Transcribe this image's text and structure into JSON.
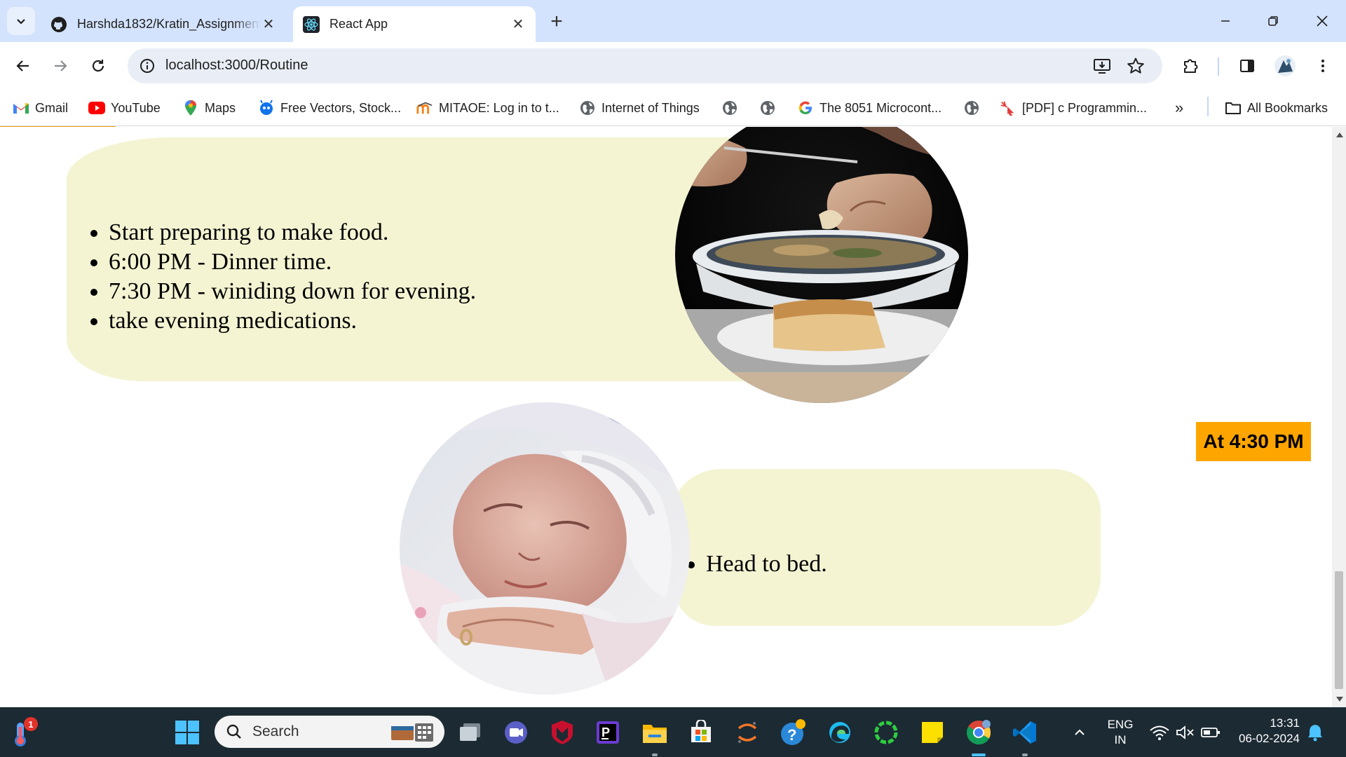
{
  "browser": {
    "tabs": [
      {
        "title": "Harshda1832/Kratin_Assignment",
        "icon": "github-icon",
        "active": false
      },
      {
        "title": "React App",
        "icon": "react-icon",
        "active": true
      }
    ],
    "new_tab_label": "+",
    "url": "localhost:3000/Routine",
    "bookmarks": [
      {
        "label": "Gmail",
        "icon": "gmail-icon"
      },
      {
        "label": "YouTube",
        "icon": "youtube-icon"
      },
      {
        "label": "Maps",
        "icon": "maps-icon"
      },
      {
        "label": "Free Vectors, Stock...",
        "icon": "freepik-icon"
      },
      {
        "label": "MITAOE: Log in to t...",
        "icon": "moodle-icon"
      },
      {
        "label": "Internet of Things",
        "icon": "globe-icon"
      },
      {
        "label": "",
        "icon": "globe-icon"
      },
      {
        "label": "",
        "icon": "globe-icon"
      },
      {
        "label": "The 8051 Microcont...",
        "icon": "google-icon"
      },
      {
        "label": "",
        "icon": "globe-icon"
      },
      {
        "label": "[PDF] c Programmin...",
        "icon": "pdf-site-icon"
      }
    ],
    "more_bookmarks": "»",
    "all_bookmarks": "All Bookmarks"
  },
  "page": {
    "evening_items": [
      "Start preparing to make food.",
      "6:00 PM - Dinner time.",
      "7:30 PM - winiding down for evening.",
      "take evening medications."
    ],
    "night_items": [
      "Head to bed."
    ],
    "time_badge": "At 4:30 PM",
    "colors": {
      "card": "#f4f4d3",
      "badge": "#ffa500"
    }
  },
  "taskbar": {
    "search_placeholder": "Search",
    "notification_count": "1",
    "language_top": "ENG",
    "language_bottom": "IN",
    "time": "13:31",
    "date": "06-02-2024"
  }
}
